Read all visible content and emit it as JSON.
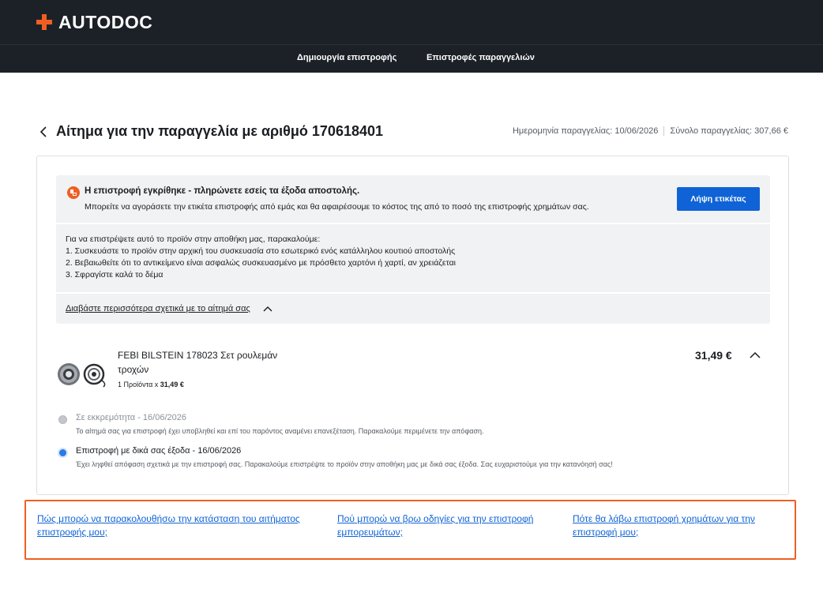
{
  "brand": {
    "name": "AUTODOC",
    "accent": "#f05f22"
  },
  "nav": {
    "create_return": "Δημιουργία επιστροφής",
    "order_returns": "Επιστροφές παραγγελιών"
  },
  "page": {
    "title": "Αίτημα για την παραγγελία με αριθμό 170618401",
    "order_date": "Ημερομηνία παραγγελίας: 10/06/2026",
    "order_total": "Σύνολο παραγγελίας: 307,66 €"
  },
  "notice": {
    "title": "Η επιστροφή εγκρίθηκε - πληρώνετε εσείς τα έξοδα αποστολής.",
    "text": "Μπορείτε να αγοράσετε την ετικέτα επιστροφής από εμάς και θα αφαιρέσουμε το κόστος της από το ποσό της επιστροφής χρημάτων σας.",
    "button_label": "Λήψη ετικέτας",
    "icon": "return-package-icon"
  },
  "instructions": {
    "intro": "Για να επιστρέψετε αυτό το προϊόν στην αποθήκη μας, παρακαλούμε:",
    "steps": [
      "1. Συσκευάστε το προϊόν στην αρχική του συσκευασία στο εσωτερικό ενός κατάλληλου κουτιού αποστολής",
      "2. Βεβαιωθείτε ότι το αντικείμενο είναι ασφαλώς συσκευασμένο με πρόσθετο χαρτόνι ή χαρτί, αν χρειάζεται",
      "3. Σφραγίστε καλά το δέμα"
    ],
    "read_more": "Διαβάστε περισσότερα σχετικά με το αίτημά σας"
  },
  "product": {
    "name": "FEBI BILSTEIN 178023 Σετ ρουλεμάν τροχών",
    "qty_label": "1 Προϊόντα x",
    "unit_price": "31,49 €",
    "price": "31,49 €",
    "image": "wheel-bearing-kit-image"
  },
  "timeline": [
    {
      "title": "Σε εκκρεμότητα - 16/06/2026",
      "text": "Το αίτημά σας για επιστροφή έχει υποβληθεί και επί του παρόντος αναμένει επανεξέταση. Παρακαλούμε περιμένετε την απόφαση.",
      "state": "done",
      "color": "#c3c6ca"
    },
    {
      "title": "Επιστροφή με δικά σας έξοδα - 16/06/2026",
      "text": "Έχει ληφθεί απόφαση σχετικά με την επιστροφή σας. Παρακαλούμε επιστρέψτε το προϊόν στην αποθήκη μας με δικά σας έξοδα. Σας ευχαριστούμε για την κατανόησή σας!",
      "state": "current",
      "color": "#2a7be4"
    }
  ],
  "faq": {
    "track": "Πώς μπορώ να παρακολουθήσω την κατάσταση του αιτήματος επιστροφής μου;",
    "guide": "Πού μπορώ να βρω οδηγίες για την επιστροφή εμπορευμάτων;",
    "refund": "Πότε θα λάβω επιστροφή χρημάτων για την επιστροφή μου;"
  }
}
